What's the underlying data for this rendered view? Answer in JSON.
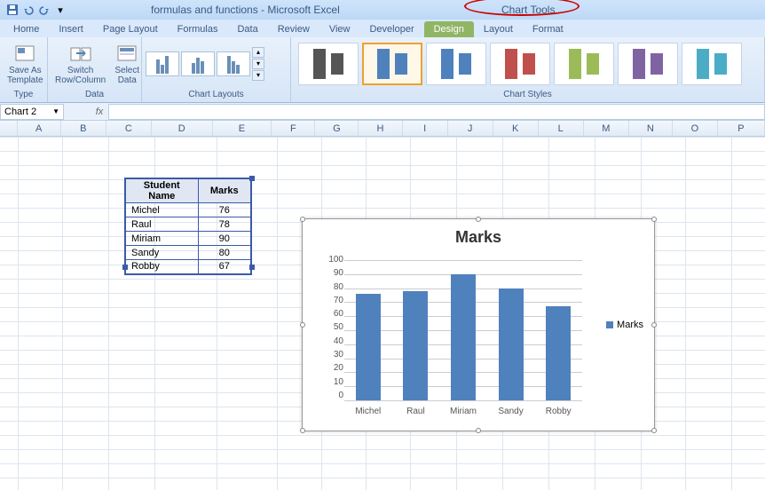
{
  "titlebar": {
    "doc_title": "formulas and functions - Microsoft Excel",
    "context_tab": "Chart Tools"
  },
  "tabs": {
    "home": "Home",
    "insert": "Insert",
    "page_layout": "Page Layout",
    "formulas": "Formulas",
    "data": "Data",
    "review": "Review",
    "view": "View",
    "developer": "Developer",
    "design": "Design",
    "layout": "Layout",
    "format": "Format"
  },
  "ribbon": {
    "type_group": "Type",
    "save_as_template": "Save As Template",
    "data_group": "Data",
    "switch_rowcol": "Switch Row/Column",
    "select_data": "Select Data",
    "chart_layouts": "Chart Layouts",
    "chart_styles": "Chart Styles"
  },
  "formula_bar": {
    "name_box": "Chart 2",
    "fx": "fx"
  },
  "columns": [
    "A",
    "B",
    "C",
    "D",
    "E",
    "F",
    "G",
    "H",
    "I",
    "J",
    "K",
    "L",
    "M",
    "N",
    "O",
    "P"
  ],
  "table": {
    "header_name": "Student Name",
    "header_marks": "Marks",
    "rows": [
      {
        "name": "Michel",
        "marks": "76"
      },
      {
        "name": "Raul",
        "marks": "78"
      },
      {
        "name": "Miriam",
        "marks": "90"
      },
      {
        "name": "Sandy",
        "marks": "80"
      },
      {
        "name": "Robby",
        "marks": "67"
      }
    ]
  },
  "chart_data": {
    "type": "bar",
    "title": "Marks",
    "categories": [
      "Michel",
      "Raul",
      "Miriam",
      "Sandy",
      "Robby"
    ],
    "series": [
      {
        "name": "Marks",
        "values": [
          76,
          78,
          90,
          80,
          67
        ]
      }
    ],
    "ylim": [
      0,
      100
    ],
    "yticks": [
      "0",
      "10",
      "20",
      "30",
      "40",
      "50",
      "60",
      "70",
      "80",
      "90",
      "100"
    ],
    "legend": "Marks"
  },
  "style_colors": [
    "#555",
    "#4f81bd",
    "#4f81bd",
    "#c0504d",
    "#9bbb59",
    "#8064a2",
    "#4bacc6"
  ]
}
